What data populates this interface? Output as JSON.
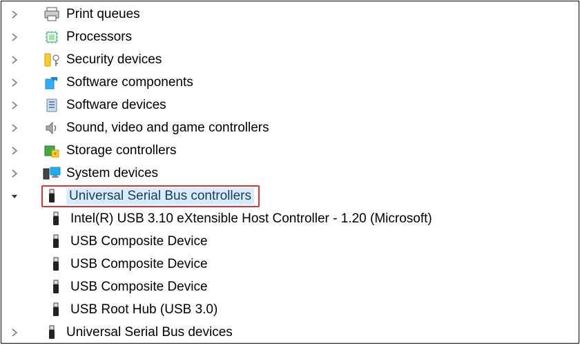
{
  "tree": {
    "items": [
      {
        "label": "Print queues",
        "icon": "printer-icon",
        "expanded": false
      },
      {
        "label": "Processors",
        "icon": "chip-icon",
        "expanded": false
      },
      {
        "label": "Security devices",
        "icon": "security-icon",
        "expanded": false
      },
      {
        "label": "Software components",
        "icon": "software-comp-icon",
        "expanded": false
      },
      {
        "label": "Software devices",
        "icon": "software-dev-icon",
        "expanded": false
      },
      {
        "label": "Sound, video and game controllers",
        "icon": "speaker-icon",
        "expanded": false
      },
      {
        "label": "Storage controllers",
        "icon": "storage-icon",
        "expanded": false
      },
      {
        "label": "System devices",
        "icon": "system-icon",
        "expanded": false
      },
      {
        "label": "Universal Serial Bus controllers",
        "icon": "usb-icon",
        "expanded": true,
        "highlighted": true,
        "children": [
          {
            "label": "Intel(R) USB 3.10 eXtensible Host Controller - 1.20 (Microsoft)",
            "icon": "usb-icon"
          },
          {
            "label": "USB Composite Device",
            "icon": "usb-icon"
          },
          {
            "label": "USB Composite Device",
            "icon": "usb-icon"
          },
          {
            "label": "USB Composite Device",
            "icon": "usb-icon"
          },
          {
            "label": "USB Root Hub (USB 3.0)",
            "icon": "usb-icon"
          }
        ]
      },
      {
        "label": "Universal Serial Bus devices",
        "icon": "usb-icon",
        "expanded": false
      }
    ]
  }
}
